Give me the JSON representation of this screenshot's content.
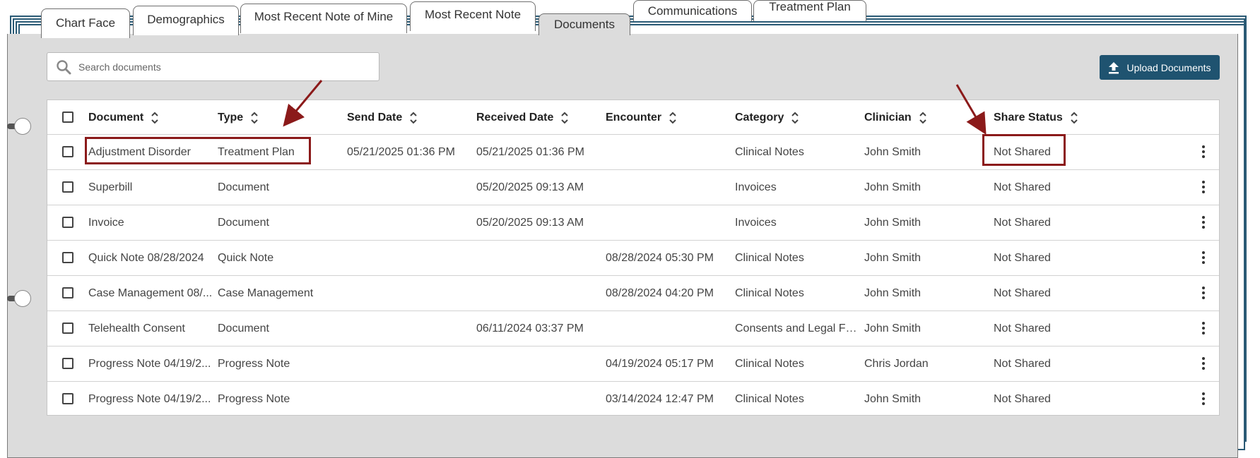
{
  "tabs": {
    "chart_face": "Chart Face",
    "demographics": "Demographics",
    "most_recent_note_of_mine": "Most Recent Note of Mine",
    "most_recent_note": "Most Recent Note",
    "documents": "Documents",
    "communications": "Communications",
    "treatment_plan": "Treatment Plan"
  },
  "search": {
    "placeholder": "Search documents"
  },
  "upload_button": {
    "label": "Upload Documents"
  },
  "table": {
    "columns": {
      "document": "Document",
      "type": "Type",
      "send_date": "Send Date",
      "received_date": "Received Date",
      "encounter": "Encounter",
      "category": "Category",
      "clinician": "Clinician",
      "share_status": "Share Status"
    },
    "rows": [
      {
        "document": "Adjustment Disorder",
        "type": "Treatment Plan",
        "send_date": "05/21/2025 01:36 PM",
        "received_date": "05/21/2025 01:36 PM",
        "encounter": "",
        "category": "Clinical Notes",
        "clinician": "John Smith",
        "share_status": "Not Shared"
      },
      {
        "document": "Superbill",
        "type": "Document",
        "send_date": "",
        "received_date": "05/20/2025 09:13 AM",
        "encounter": "",
        "category": "Invoices",
        "clinician": "John Smith",
        "share_status": "Not Shared"
      },
      {
        "document": "Invoice",
        "type": "Document",
        "send_date": "",
        "received_date": "05/20/2025 09:13 AM",
        "encounter": "",
        "category": "Invoices",
        "clinician": "John Smith",
        "share_status": "Not Shared"
      },
      {
        "document": "Quick Note 08/28/2024",
        "type": "Quick Note",
        "send_date": "",
        "received_date": "",
        "encounter": "08/28/2024 05:30 PM",
        "category": "Clinical Notes",
        "clinician": "John Smith",
        "share_status": "Not Shared"
      },
      {
        "document": "Case Management 08/...",
        "type": "Case Management",
        "send_date": "",
        "received_date": "",
        "encounter": "08/28/2024 04:20 PM",
        "category": "Clinical Notes",
        "clinician": "John Smith",
        "share_status": "Not Shared"
      },
      {
        "document": "Telehealth Consent",
        "type": "Document",
        "send_date": "",
        "received_date": "06/11/2024 03:37 PM",
        "encounter": "",
        "category": "Consents and Legal For...",
        "clinician": "John Smith",
        "share_status": "Not Shared"
      },
      {
        "document": "Progress Note 04/19/2...",
        "type": "Progress Note",
        "send_date": "",
        "received_date": "",
        "encounter": "04/19/2024 05:17 PM",
        "category": "Clinical Notes",
        "clinician": "Chris Jordan",
        "share_status": "Not Shared"
      },
      {
        "document": "Progress Note 04/19/2...",
        "type": "Progress Note",
        "send_date": "",
        "received_date": "",
        "encounter": "03/14/2024 12:47 PM",
        "category": "Clinical Notes",
        "clinician": "John Smith",
        "share_status": "Not Shared"
      }
    ]
  },
  "icons": {
    "search": "search-icon",
    "upload": "upload-icon",
    "sort": "sort-icon",
    "kebab": "kebab-menu-icon"
  },
  "colors": {
    "accent": "#1f5370",
    "annotation": "#8b1a1a",
    "binder": "#2a5a75"
  }
}
